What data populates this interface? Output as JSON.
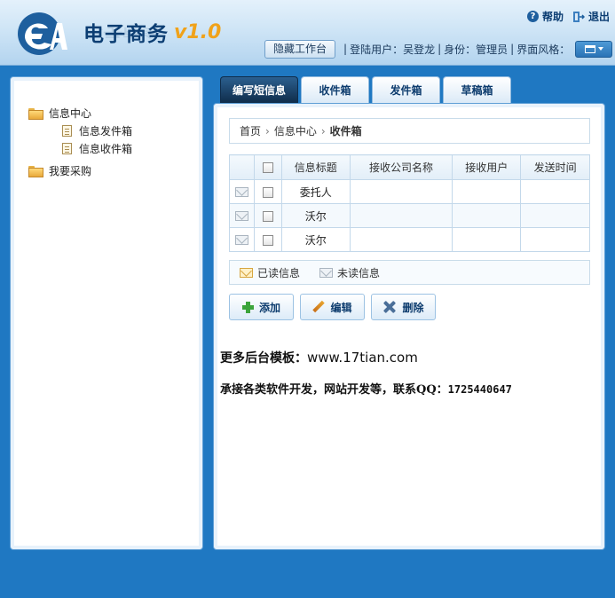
{
  "header": {
    "logo_text": "电子商务",
    "logo_version": "v1.0",
    "help_label": "帮助",
    "exit_label": "退出",
    "hide_button": "隐藏工作台",
    "user_info": "登陆用户：吴登龙",
    "role_info": "身份：管理员",
    "style_label": "界面风格："
  },
  "sidebar": {
    "items": [
      {
        "label": "信息中心",
        "icon": "folder-icon",
        "children": [
          "信息发件箱",
          "信息收件箱"
        ]
      },
      {
        "label": "我要采购",
        "icon": "folder-icon"
      }
    ]
  },
  "tabs": [
    {
      "label": "编写短信息",
      "active": true
    },
    {
      "label": "收件箱",
      "active": false
    },
    {
      "label": "发件箱",
      "active": false
    },
    {
      "label": "草稿箱",
      "active": false
    }
  ],
  "breadcrumb": {
    "home": "首页",
    "section": "信息中心",
    "current": "收件箱"
  },
  "table": {
    "headers": [
      "信息标题",
      "接收公司名称",
      "接收用户",
      "发送时间"
    ],
    "rows": [
      {
        "title": "委托人",
        "company": "",
        "user": "",
        "time": ""
      },
      {
        "title": "沃尔",
        "company": "",
        "user": "",
        "time": ""
      },
      {
        "title": "沃尔",
        "company": "",
        "user": "",
        "time": ""
      }
    ]
  },
  "legend": {
    "read": "已读信息",
    "unread": "未读信息"
  },
  "actions": {
    "add": "添加",
    "edit": "编辑",
    "delete": "删除"
  },
  "promo": {
    "line1_prefix": "更多后台模板：",
    "line1_url": "www.17tian.com",
    "line2_prefix": "承接各类软件开发，网站开发等，联系QQ：",
    "line2_qq": "1725440647"
  },
  "colors": {
    "accent": "#1f78c2",
    "brand": "#0c3e73",
    "version": "#f0a21a"
  }
}
